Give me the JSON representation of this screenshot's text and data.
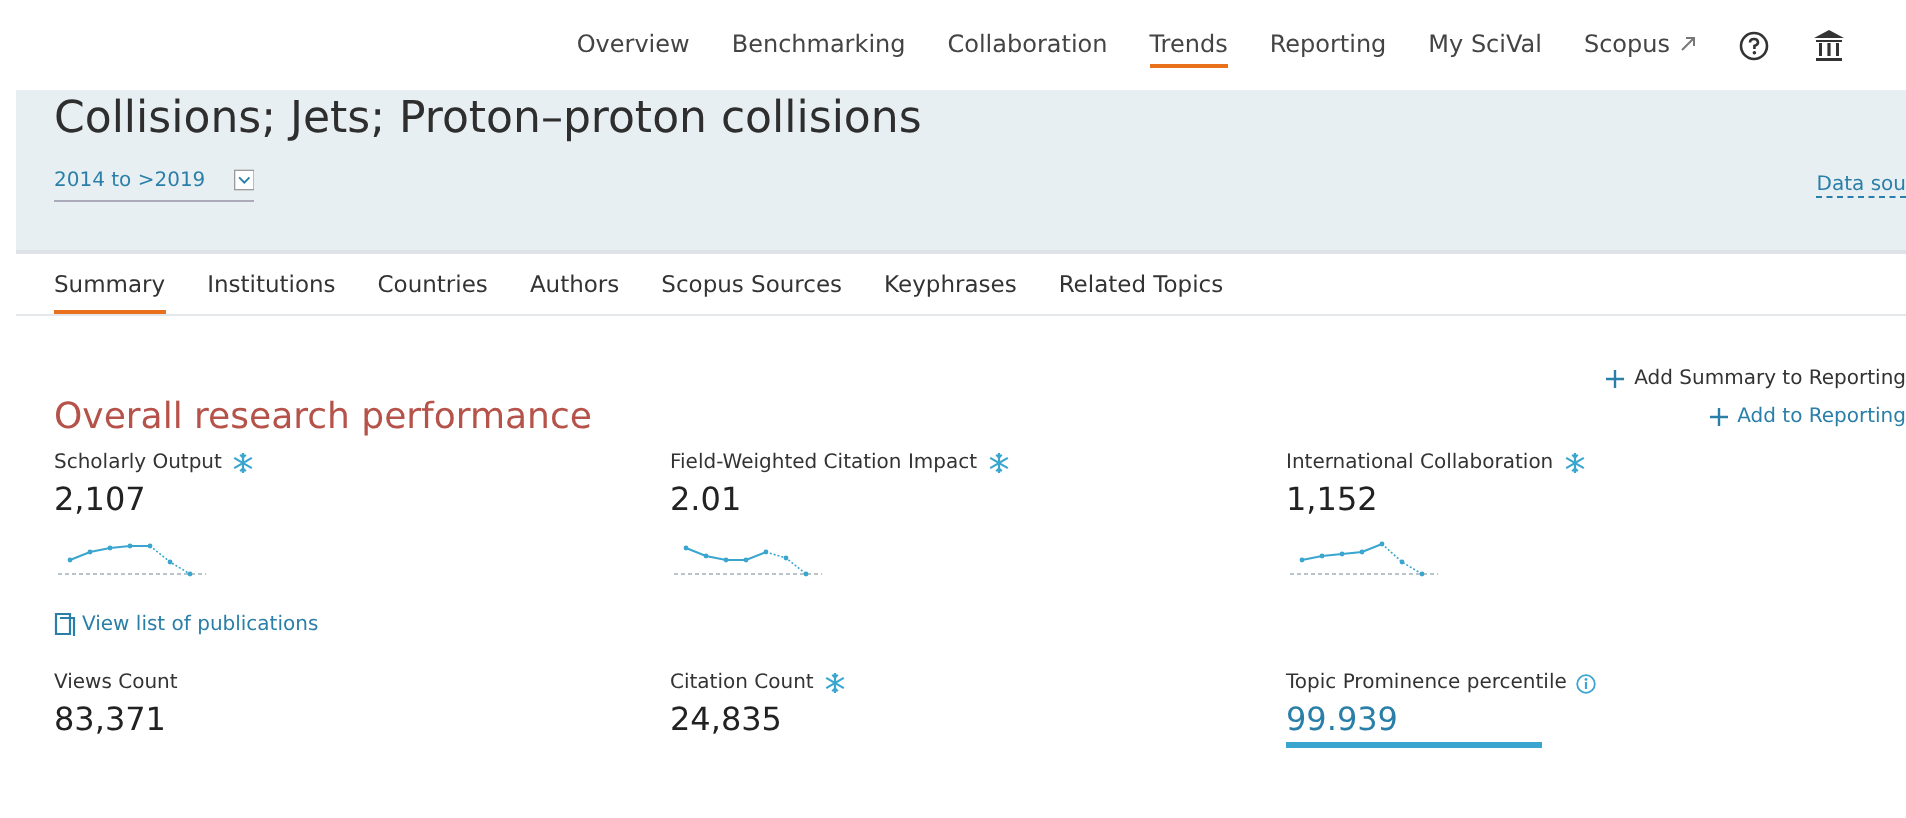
{
  "nav": {
    "items": [
      {
        "label": "Overview",
        "selected": false,
        "kind": "page"
      },
      {
        "label": "Benchmarking",
        "selected": false,
        "kind": "page"
      },
      {
        "label": "Collaboration",
        "selected": false,
        "kind": "page"
      },
      {
        "label": "Trends",
        "selected": true,
        "kind": "page"
      },
      {
        "label": "Reporting",
        "selected": false,
        "kind": "page"
      },
      {
        "label": "My SciVal",
        "selected": false,
        "kind": "page"
      },
      {
        "label": "Scopus",
        "selected": false,
        "kind": "external"
      }
    ]
  },
  "header": {
    "title": "Collisions; Jets; Proton–proton collisions",
    "period": "2014 to >2019",
    "data_source_link": "Data sou"
  },
  "tabs": [
    {
      "label": "Summary",
      "selected": true
    },
    {
      "label": "Institutions",
      "selected": false
    },
    {
      "label": "Countries",
      "selected": false
    },
    {
      "label": "Authors",
      "selected": false
    },
    {
      "label": "Scopus Sources",
      "selected": false
    },
    {
      "label": "Keyphrases",
      "selected": false
    },
    {
      "label": "Related Topics",
      "selected": false
    }
  ],
  "actions": {
    "add_summary": "Add Summary to Reporting",
    "add": "Add to Reporting"
  },
  "section_title": "Overall research performance",
  "metrics_top": [
    {
      "label": "Scholarly Output",
      "value": "2,107",
      "kind": "trend"
    },
    {
      "label": "Field-Weighted Citation Impact",
      "value": "2.01",
      "kind": "trend"
    },
    {
      "label": "International Collaboration",
      "value": "1,152",
      "kind": "trend"
    }
  ],
  "publications_link": "View list of publications",
  "metrics_bottom": [
    {
      "label": "Views Count",
      "value": "83,371",
      "kind": "plain"
    },
    {
      "label": "Citation Count",
      "value": "24,835",
      "kind": "snapshot"
    },
    {
      "label": "Topic Prominence percentile",
      "value": "99.939",
      "kind": "percentile"
    }
  ]
}
